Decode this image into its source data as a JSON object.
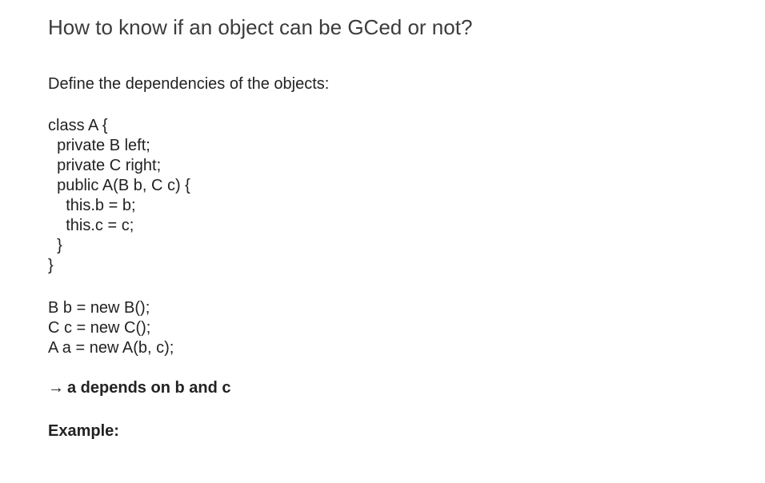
{
  "title": "How to know if an object can be GCed or not?",
  "subtitle": "Define the dependencies of the objects:",
  "class_code": [
    "class A {",
    "  private B left;",
    "  private C right;",
    "  public A(B b, C c) {",
    "    this.b = b;",
    "    this.c = c;",
    "  }",
    "}"
  ],
  "instance_code": [
    "B b = new B();",
    "C c = new C();",
    "A a = new A(b, c);"
  ],
  "conclusion": {
    "arrow": "→",
    "text": "a depends on b and c"
  },
  "example_label": "Example:"
}
